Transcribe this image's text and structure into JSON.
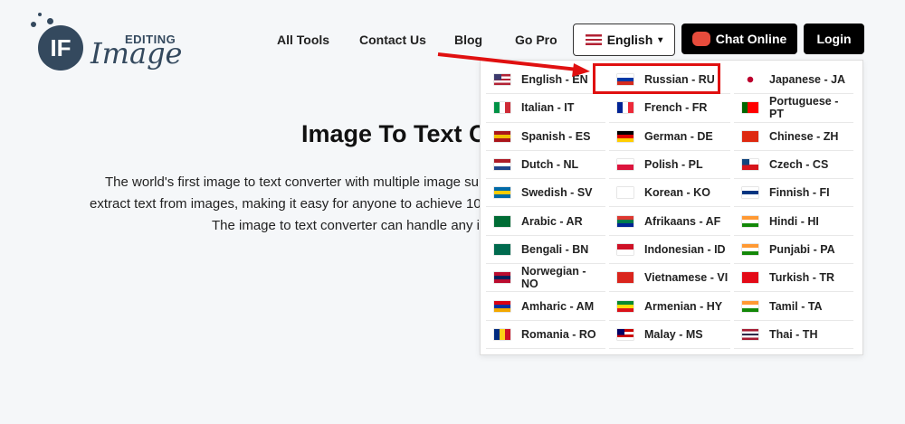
{
  "logo": {
    "mark": "IF",
    "line1": "EDITING",
    "line2": "Image"
  },
  "nav": [
    "All Tools",
    "Contact Us",
    "Blog",
    "Go Pro"
  ],
  "language_button": {
    "label": "English",
    "caret": "▾"
  },
  "chat_button": "Chat Online",
  "login_button": "Login",
  "title": "Image To Text C",
  "description": [
    "The world's first image to text converter with multiple image su",
    "extract text from images, making it easy for anyone to achieve 10",
    "The image to text converter can handle any i"
  ],
  "highlight_color": "#e01010",
  "languages": [
    {
      "label": "English - EN",
      "flag": [
        "#b22234",
        "#fff",
        "#b22234",
        "#fff",
        "#b22234"
      ],
      "canton": "#3c3b6e"
    },
    {
      "label": "Russian - RU",
      "flag": [
        "#fff",
        "#0039a6",
        "#d52b1e"
      ]
    },
    {
      "label": "Japanese - JA",
      "flag": [
        "dot"
      ]
    },
    {
      "label": "Italian - IT",
      "flag": [
        "#009246",
        "#fff",
        "#ce2b37"
      ],
      "vertical": true
    },
    {
      "label": "French - FR",
      "flag": [
        "#002395",
        "#fff",
        "#ed2939"
      ],
      "vertical": true
    },
    {
      "label": "Portuguese - PT",
      "flag": [
        "#006600",
        "#ff0000",
        "#ff0000"
      ],
      "vertical": true
    },
    {
      "label": "Spanish - ES",
      "flag": [
        "#aa151b",
        "#f1bf00",
        "#aa151b"
      ]
    },
    {
      "label": "German - DE",
      "flag": [
        "#000",
        "#dd0000",
        "#ffce00"
      ]
    },
    {
      "label": "Chinese - ZH",
      "flag": [
        "#de2910"
      ]
    },
    {
      "label": "Dutch - NL",
      "flag": [
        "#ae1c28",
        "#fff",
        "#21468b"
      ]
    },
    {
      "label": "Polish - PL",
      "flag": [
        "#fff",
        "#dc143c"
      ]
    },
    {
      "label": "Czech - CS",
      "flag": [
        "#fff",
        "#d7141a"
      ],
      "canton": "#11457e"
    },
    {
      "label": "Swedish - SV",
      "flag": [
        "#006aa7",
        "#fecc00",
        "#006aa7"
      ]
    },
    {
      "label": "Korean - KO",
      "flag": [
        "#fff"
      ]
    },
    {
      "label": "Finnish - FI",
      "flag": [
        "#fff",
        "#003580",
        "#fff"
      ]
    },
    {
      "label": "Arabic - AR",
      "flag": [
        "#006c35"
      ]
    },
    {
      "label": "Afrikaans - AF",
      "flag": [
        "#de3831",
        "#007a4d",
        "#002395"
      ]
    },
    {
      "label": "Hindi - HI",
      "flag": [
        "#ff9933",
        "#fff",
        "#138808"
      ]
    },
    {
      "label": "Bengali - BN",
      "flag": [
        "#006a4e"
      ]
    },
    {
      "label": "Indonesian - ID",
      "flag": [
        "#ce1126",
        "#fff"
      ]
    },
    {
      "label": "Punjabi - PA",
      "flag": [
        "#ff9933",
        "#fff",
        "#138808"
      ]
    },
    {
      "label": "Norwegian - NO",
      "flag": [
        "#ba0c2f",
        "#00205b",
        "#ba0c2f"
      ]
    },
    {
      "label": "Vietnamese - VI",
      "flag": [
        "#da251d"
      ]
    },
    {
      "label": "Turkish - TR",
      "flag": [
        "#e30a17"
      ]
    },
    {
      "label": "Amharic - AM",
      "flag": [
        "#d90012",
        "#0033a0",
        "#f2a800"
      ]
    },
    {
      "label": "Armenian - HY",
      "flag": [
        "#078930",
        "#fcdd09",
        "#da121a"
      ]
    },
    {
      "label": "Tamil - TA",
      "flag": [
        "#ff9933",
        "#fff",
        "#138808"
      ]
    },
    {
      "label": "Romania - RO",
      "flag": [
        "#002b7f",
        "#fcd116",
        "#ce1126"
      ],
      "vertical": true
    },
    {
      "label": "Malay - MS",
      "flag": [
        "#cc0001",
        "#fff",
        "#cc0001",
        "#fff"
      ],
      "canton": "#010066"
    },
    {
      "label": "Thai - TH",
      "flag": [
        "#a51931",
        "#f4f5f8",
        "#2d2a4a",
        "#f4f5f8",
        "#a51931"
      ]
    }
  ]
}
